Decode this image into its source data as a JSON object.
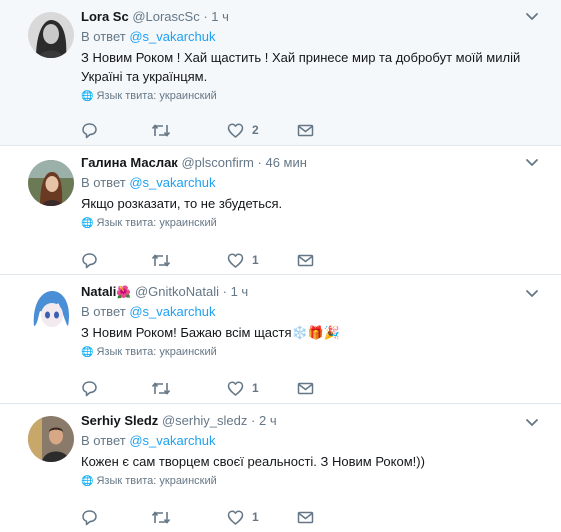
{
  "tweets": [
    {
      "name": "Lora Sc",
      "badge": "",
      "handle": "@LorascSc",
      "dot": "·",
      "time": "1 ч",
      "reply_prefix": "В ответ",
      "mention": "@s_vakarchuk",
      "text": "З Новим Роком ! Хай щастить ! Хай принесе мир та добробут моїй милій Україні та українцям.",
      "lang_label": "Язык твита: украинский",
      "like_count": "2",
      "colors": {
        "bg": "#f5f8fa"
      }
    },
    {
      "name": "Галина Маслак",
      "badge": "",
      "handle": "@plsconfirm",
      "dot": "·",
      "time": "46 мин",
      "reply_prefix": "В ответ",
      "mention": "@s_vakarchuk",
      "text": "Якщо розказати, то не збудеться.",
      "lang_label": "Язык твита: украинский",
      "like_count": "1",
      "colors": {
        "bg": "#ffffff"
      }
    },
    {
      "name": "Natali",
      "badge": "🌺",
      "handle": "@GnitkoNatali",
      "dot": "·",
      "time": "1 ч",
      "reply_prefix": "В ответ",
      "mention": "@s_vakarchuk",
      "text": "З Новим Роком! Бажаю всім щастя❄️🎁🎉",
      "lang_label": "Язык твита: украинский",
      "like_count": "1",
      "colors": {
        "bg": "#ffffff"
      }
    },
    {
      "name": "Serhiy Sledz",
      "badge": "",
      "handle": "@serhiy_sledz",
      "dot": "·",
      "time": "2 ч",
      "reply_prefix": "В ответ",
      "mention": "@s_vakarchuk",
      "text": "Кожен є сам творцем своєї реальності. З Новим Роком!))",
      "lang_label": "Язык твита: украинский",
      "like_count": "1",
      "colors": {
        "bg": "#ffffff"
      }
    }
  ],
  "icons": {
    "reply": "reply-icon",
    "retweet": "retweet-icon",
    "like": "heart-icon",
    "dm": "envelope-icon",
    "caret": "chevron-down-icon",
    "lang": "globe-icon"
  },
  "colors": {
    "text": "#14171a",
    "muted": "#657786",
    "link": "#1da1f2",
    "border": "#e1e8ed"
  }
}
